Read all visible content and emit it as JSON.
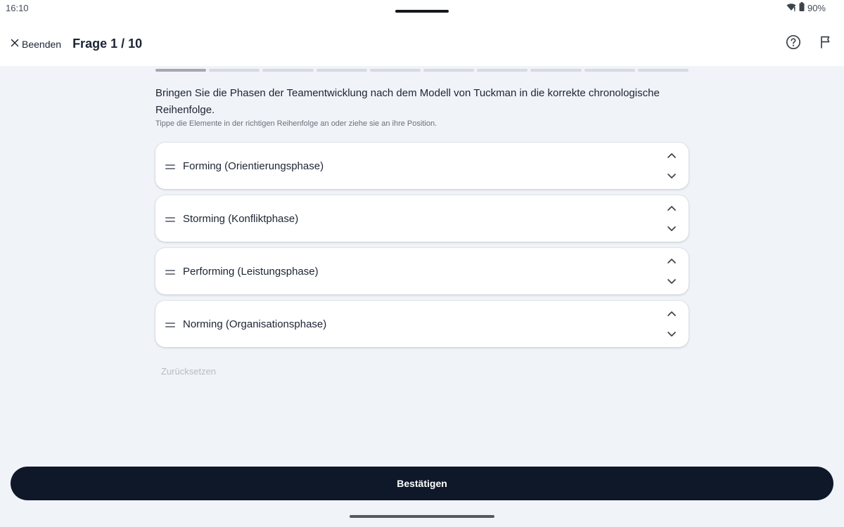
{
  "status_bar": {
    "time": "16:10",
    "battery": "90%"
  },
  "app_bar": {
    "close_label": "Beenden",
    "title": "Frage 1 / 10"
  },
  "progress": {
    "current": 1,
    "total": 10
  },
  "question": {
    "text": "Bringen Sie die Phasen der Teamentwicklung nach dem Modell von Tuckman in die korrekte chronologische Reihenfolge.",
    "hint": "Tippe die Elemente in der richtigen Reihenfolge an oder ziehe sie an ihre Position."
  },
  "items": [
    {
      "label": "Forming (Orientierungsphase)"
    },
    {
      "label": "Storming (Konfliktphase)"
    },
    {
      "label": "Performing (Leistungsphase)"
    },
    {
      "label": "Norming (Organisationsphase)"
    }
  ],
  "reset_label": "Zurücksetzen",
  "confirm_label": "Bestätigen",
  "icons": [
    "close-icon",
    "help-circle-icon",
    "flag-icon",
    "drag-handle-icon",
    "chevron-up-icon",
    "chevron-down-icon",
    "wifi-icon",
    "battery-icon"
  ]
}
